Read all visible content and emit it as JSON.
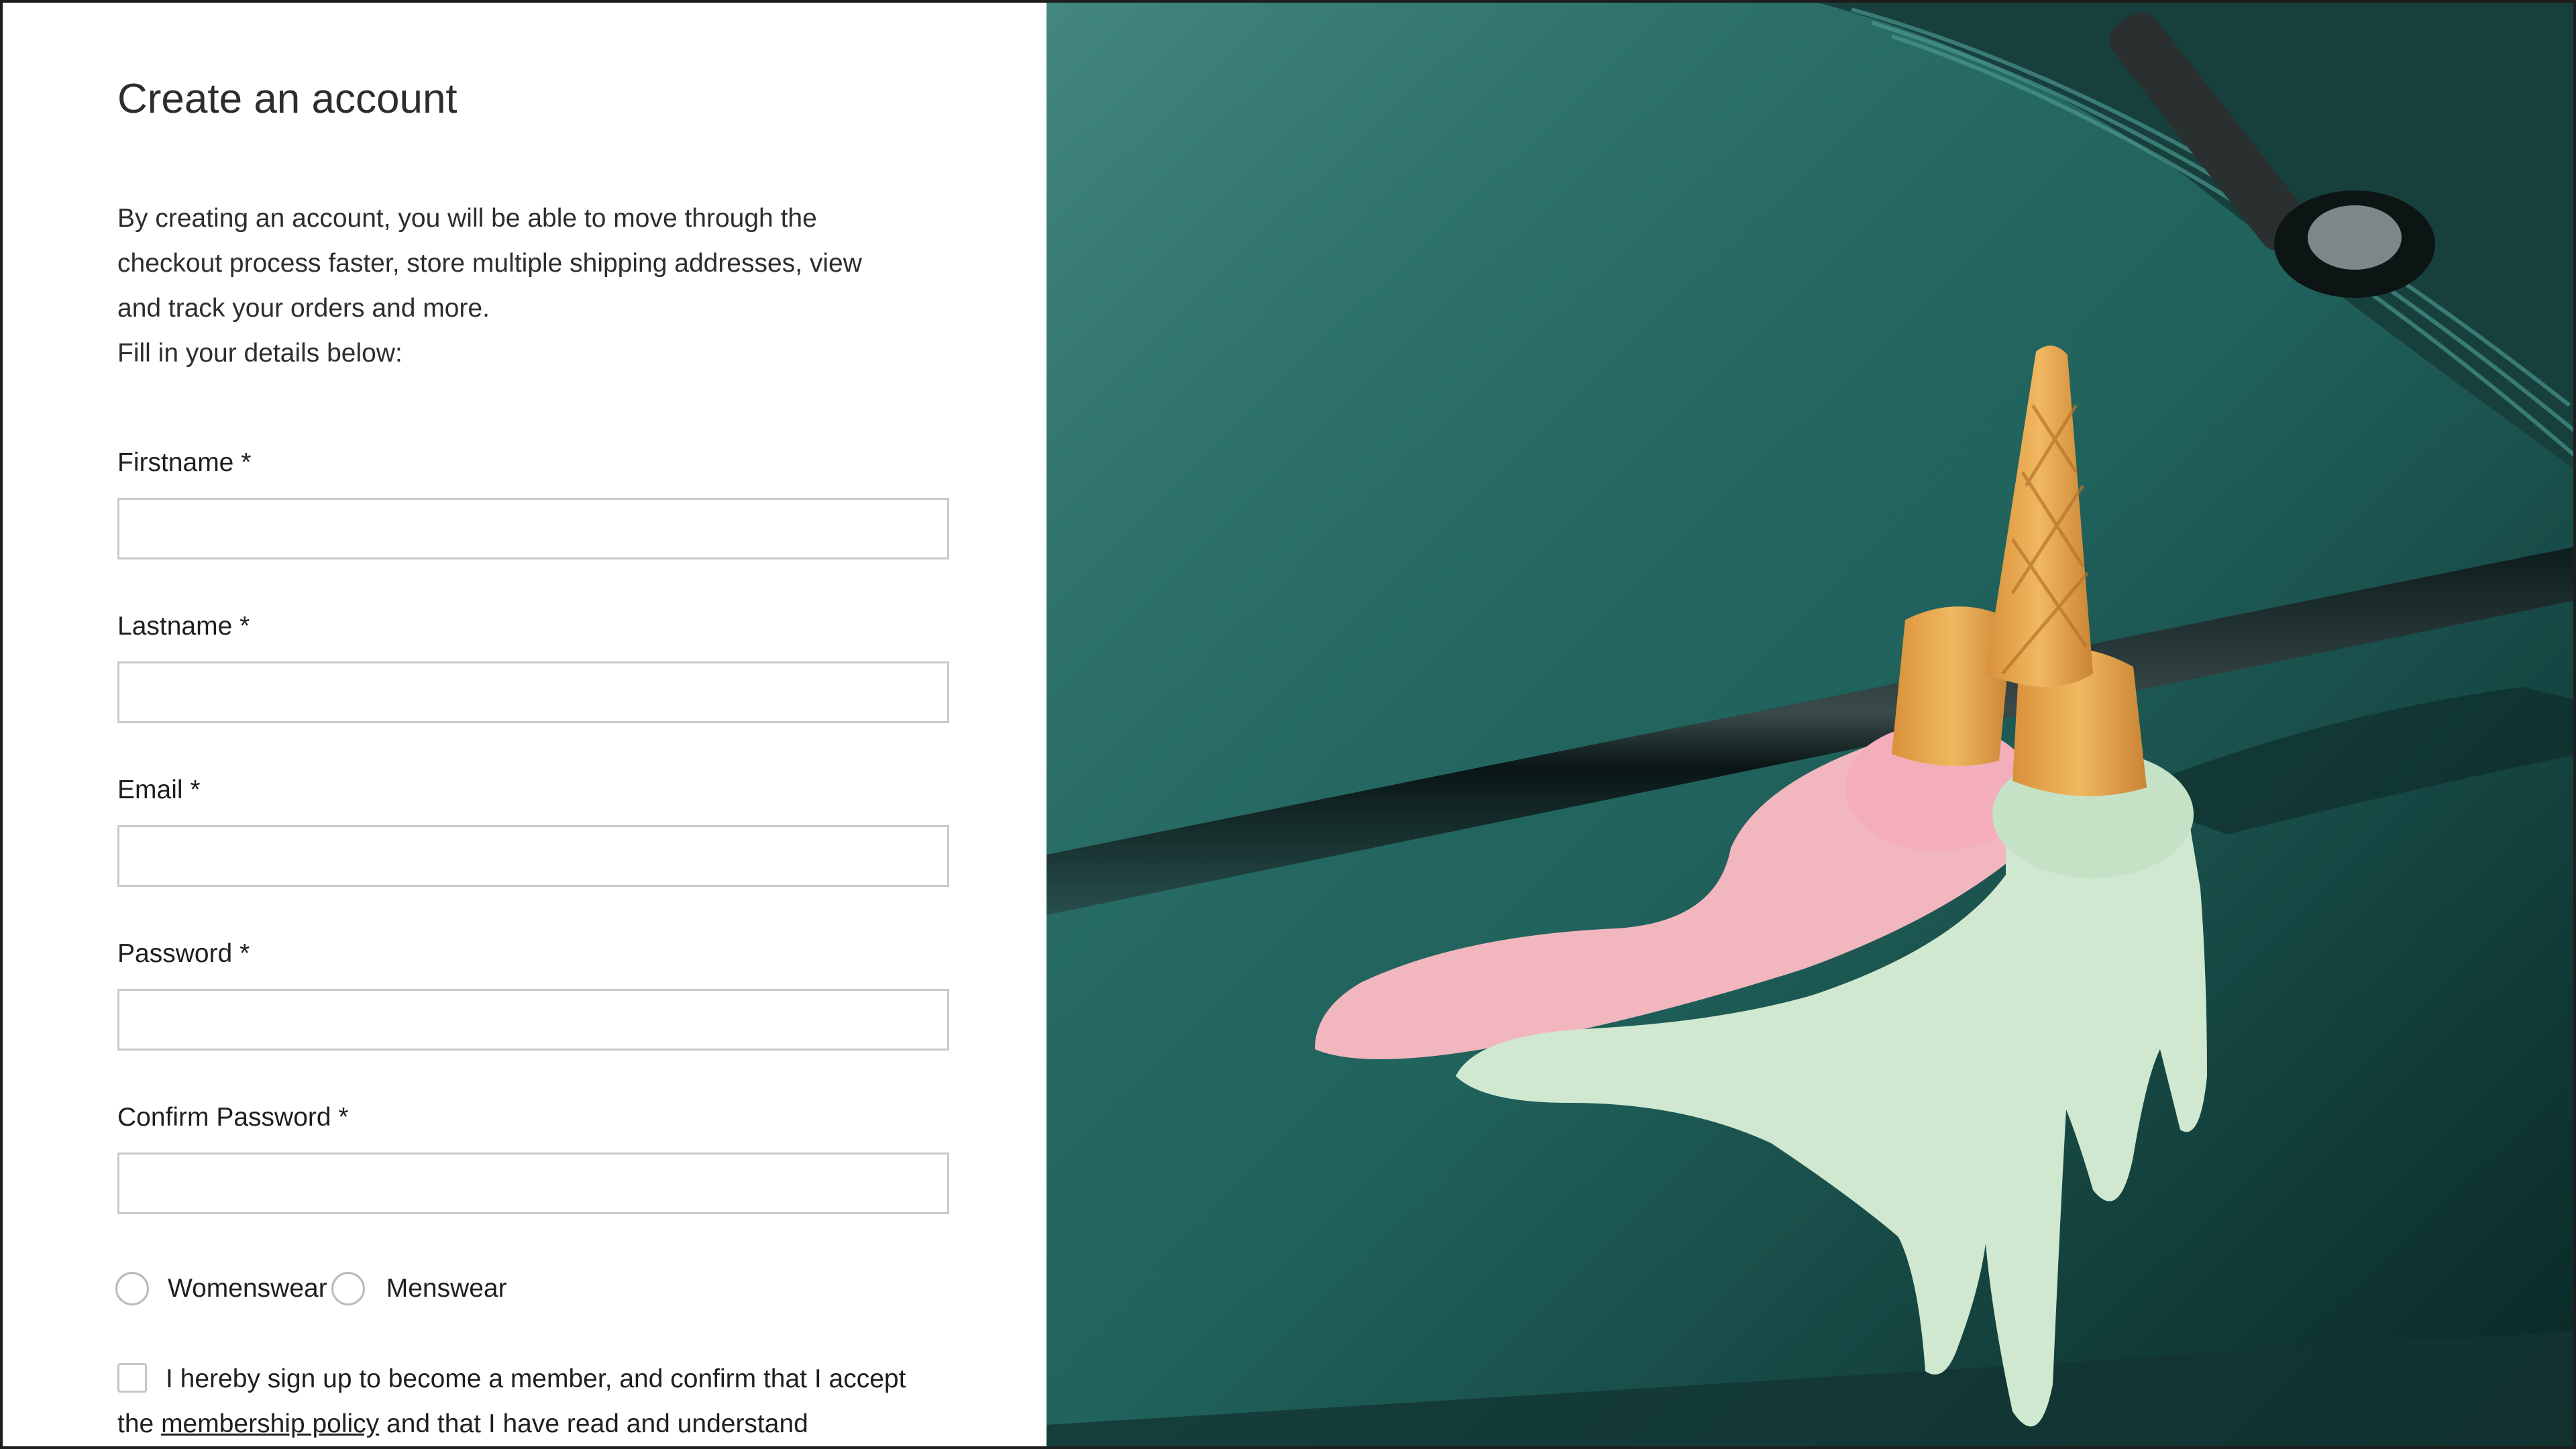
{
  "form": {
    "title": "Create an account",
    "intro_lines": [
      "By creating an account, you will be able to move through the",
      "checkout process faster, store multiple shipping addresses, view",
      "and track your orders and more.",
      "Fill in your details below:"
    ],
    "fields": {
      "firstname": {
        "label": "Firstname *",
        "value": ""
      },
      "lastname": {
        "label": "Lastname *",
        "value": ""
      },
      "email": {
        "label": "Email *",
        "value": ""
      },
      "password": {
        "label": "Password *",
        "value": ""
      },
      "confirm_password": {
        "label": "Confirm Password *",
        "value": ""
      }
    },
    "preferences": {
      "womenswear": "Womenswear",
      "menswear": "Menswear"
    },
    "terms": {
      "text_before": "I hereby sign up to become a member, and confirm that I accept the ",
      "link": "membership policy",
      "text_after": " and that I have read and understand"
    }
  },
  "image": {
    "background_color": "#246a63",
    "pink_color": "#f2b6be",
    "mint_color": "#cfe8cf",
    "cone_color": "#e8a44a"
  }
}
